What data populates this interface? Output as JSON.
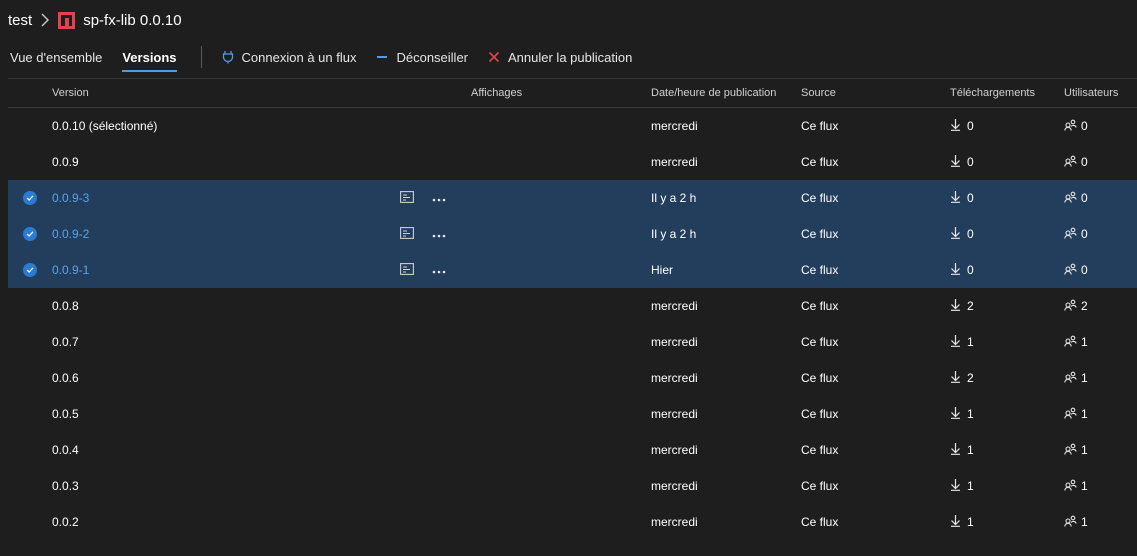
{
  "breadcrumb": {
    "project": "test",
    "package": "sp-fx-lib 0.0.10"
  },
  "tabs": [
    {
      "label": "Vue d'ensemble",
      "active": false
    },
    {
      "label": "Versions",
      "active": true
    }
  ],
  "actions": {
    "connect": "Connexion à un flux",
    "deprecate": "Déconseiller",
    "unpublish": "Annuler la publication"
  },
  "columns": {
    "version": "Version",
    "views": "Affichages",
    "date": "Date/heure de publication",
    "source": "Source",
    "downloads": "Téléchargements",
    "users": "Utilisateurs"
  },
  "rows": [
    {
      "version": "0.0.10 (sélectionné)",
      "date": "mercredi",
      "source": "Ce flux",
      "downloads": "0",
      "users": "0",
      "selected": false
    },
    {
      "version": "0.0.9",
      "date": "mercredi",
      "source": "Ce flux",
      "downloads": "0",
      "users": "0",
      "selected": false
    },
    {
      "version": "0.0.9-3",
      "date": "Il y a 2 h",
      "source": "Ce flux",
      "downloads": "0",
      "users": "0",
      "selected": true
    },
    {
      "version": "0.0.9-2",
      "date": "Il y a 2 h",
      "source": "Ce flux",
      "downloads": "0",
      "users": "0",
      "selected": true
    },
    {
      "version": "0.0.9-1",
      "date": "Hier",
      "source": "Ce flux",
      "downloads": "0",
      "users": "0",
      "selected": true
    },
    {
      "version": "0.0.8",
      "date": "mercredi",
      "source": "Ce flux",
      "downloads": "2",
      "users": "2",
      "selected": false
    },
    {
      "version": "0.0.7",
      "date": "mercredi",
      "source": "Ce flux",
      "downloads": "1",
      "users": "1",
      "selected": false
    },
    {
      "version": "0.0.6",
      "date": "mercredi",
      "source": "Ce flux",
      "downloads": "2",
      "users": "1",
      "selected": false
    },
    {
      "version": "0.0.5",
      "date": "mercredi",
      "source": "Ce flux",
      "downloads": "1",
      "users": "1",
      "selected": false
    },
    {
      "version": "0.0.4",
      "date": "mercredi",
      "source": "Ce flux",
      "downloads": "1",
      "users": "1",
      "selected": false
    },
    {
      "version": "0.0.3",
      "date": "mercredi",
      "source": "Ce flux",
      "downloads": "1",
      "users": "1",
      "selected": false
    },
    {
      "version": "0.0.2",
      "date": "mercredi",
      "source": "Ce flux",
      "downloads": "1",
      "users": "1",
      "selected": false
    }
  ],
  "colors": {
    "background": "#1e1e1e",
    "selected_row": "#233d5c",
    "accent": "#4f9ce0",
    "npm_icon": "#e0444e",
    "unpublish_icon": "#e0444e"
  },
  "icons": {
    "package": "npm-package-icon",
    "connect": "plug-icon",
    "deprecate": "minus-icon",
    "unpublish": "close-icon",
    "download": "download-arrow-icon",
    "users": "users-icon",
    "views": "views-icon",
    "more": "more-icon",
    "check": "check-circle-icon"
  }
}
